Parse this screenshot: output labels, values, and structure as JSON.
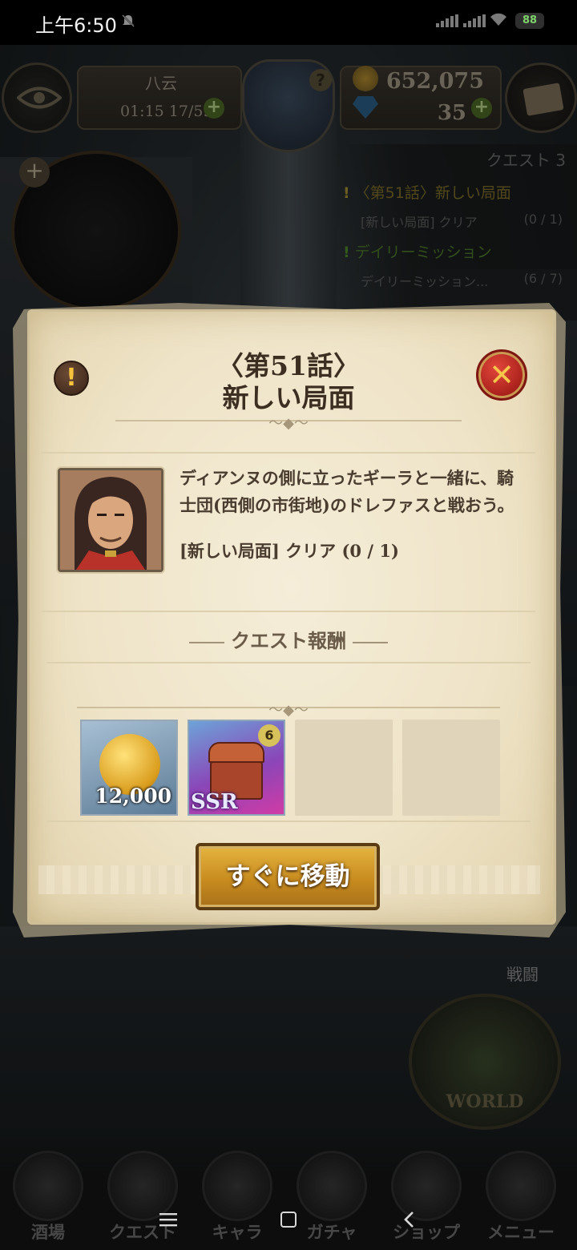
{
  "status_bar": {
    "time": "上午6:50",
    "battery": "88"
  },
  "hud": {
    "player_name": "八云",
    "stamina": "01:15 17/59",
    "gold": "652,075",
    "gems": "35"
  },
  "quest_tracker": {
    "header": "クエスト  3",
    "items": [
      {
        "title": "〈第51話〉新しい局面",
        "sub": "[新しい局面] クリア",
        "count": "(0 / 1)",
        "color": "yellow"
      },
      {
        "title": "デイリーミッション",
        "sub": "デイリーミッション...",
        "count": "(6 / 7)",
        "color": "green"
      }
    ]
  },
  "side": {
    "battle_label": "戦闘",
    "world_label": "WORLD"
  },
  "bottom_menu": [
    {
      "label": "酒場"
    },
    {
      "label": "クエスト"
    },
    {
      "label": "キャラ"
    },
    {
      "label": "ガチャ"
    },
    {
      "label": "ショップ"
    },
    {
      "label": "メニュー"
    }
  ],
  "dialog": {
    "title_line1": "〈第51話〉",
    "title_line2": "新しい局面",
    "description": "ディアンヌの側に立ったギーラと一緒に、騎士団(西側の市街地)のドレファスと戦おう。",
    "condition": "[新しい局面] クリア (0 / 1)",
    "reward_title": "クエスト報酬",
    "rewards": [
      {
        "type": "gold",
        "amount": "12,000",
        "icon": "gold-coin-icon"
      },
      {
        "type": "chest",
        "rarity": "SSR",
        "badge": "6",
        "icon": "treasure-chest-icon"
      },
      {
        "type": "empty"
      },
      {
        "type": "empty"
      }
    ],
    "go_button": "すぐに移動"
  },
  "colors": {
    "paper": "#efe4c8",
    "close_button": "#c7302a",
    "go_button": "#c88c1f",
    "text_dark": "#3d2e22"
  }
}
